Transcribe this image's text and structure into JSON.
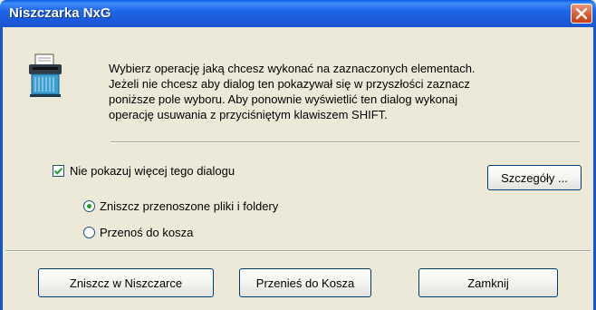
{
  "window": {
    "title": "Niszczarka NxG"
  },
  "message": {
    "line1": "Wybierz operację jaką chcesz wykonać na zaznaczonych elementach.",
    "line2": "Jeżeli nie chcesz aby dialog ten pokazywał się w przyszłości zaznacz",
    "line3": "poniższe pole wyboru. Aby ponownie wyświetlić ten dialog wykonaj",
    "line4": "operację usuwania z przyciśniętym klawiszem SHIFT."
  },
  "options": {
    "dont_show_label": "Nie pokazuj więcej tego dialogu",
    "dont_show_checked": true,
    "radio": [
      {
        "label": "Zniszcz przenoszone pliki i foldery",
        "selected": true
      },
      {
        "label": "Przenoś do kosza",
        "selected": false
      }
    ]
  },
  "buttons": {
    "details": "Szczegóły ...",
    "shred": "Zniszcz w Niszczarce",
    "move_to_trash": "Przenieś do Kosza",
    "close": "Zamknij"
  },
  "colors": {
    "titlebar": "#1f66e8",
    "dialog_bg": "#ece9d8",
    "close_button": "#d9552d",
    "check_mark": "#21a121"
  },
  "icons": {
    "app": "shredder-icon",
    "close": "close-icon"
  }
}
